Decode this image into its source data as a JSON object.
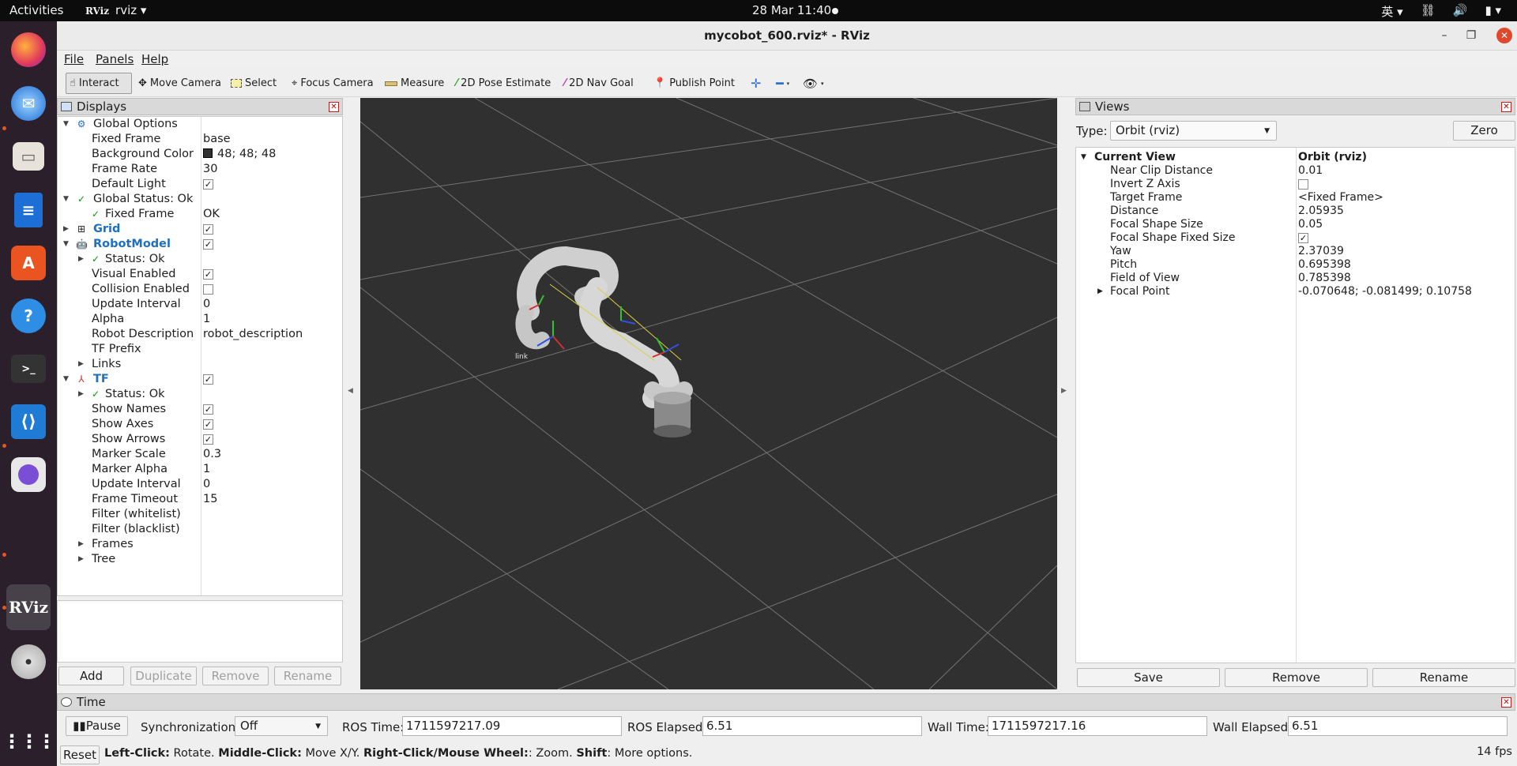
{
  "topbar": {
    "activities": "Activities",
    "app_name": "rviz",
    "app_logo": "RViz",
    "clock": "28 Mar  11:40",
    "input_method": "英",
    "tray_icons": [
      "network-icon",
      "volume-icon",
      "battery-icon"
    ]
  },
  "dock": {
    "apps": [
      "Firefox",
      "Thunderbird",
      "Files",
      "LibreOffice Writer",
      "Ubuntu Software",
      "Help",
      "Terminal",
      "Visual Studio Code",
      "Cheese",
      "RViz",
      "Disc",
      "Show Applications"
    ],
    "rviz_label": "RViz"
  },
  "window": {
    "title": "mycobot_600.rviz* - RViz",
    "menus": [
      "File",
      "Panels",
      "Help"
    ]
  },
  "toolbar": {
    "tools": [
      "Interact",
      "Move Camera",
      "Select",
      "Focus Camera",
      "Measure",
      "2D Pose Estimate",
      "2D Nav Goal",
      "Publish Point"
    ]
  },
  "displays": {
    "title": "Displays",
    "rows": {
      "global_options": "Global Options",
      "fixed_frame_lbl": "Fixed Frame",
      "fixed_frame_val": "base",
      "bg_color_lbl": "Background Color",
      "bg_color_val": "48; 48; 48",
      "frame_rate_lbl": "Frame Rate",
      "frame_rate_val": "30",
      "default_light_lbl": "Default Light",
      "global_status": "Global Status: Ok",
      "gs_fixed_frame_lbl": "Fixed Frame",
      "gs_fixed_frame_val": "OK",
      "grid": "Grid",
      "robot_model": "RobotModel",
      "rm_status": "Status: Ok",
      "visual_enabled": "Visual Enabled",
      "collision_enabled": "Collision Enabled",
      "rm_update_interval_lbl": "Update Interval",
      "rm_update_interval_val": "0",
      "alpha_lbl": "Alpha",
      "alpha_val": "1",
      "robot_desc_lbl": "Robot Description",
      "robot_desc_val": "robot_description",
      "tf_prefix": "TF Prefix",
      "links": "Links",
      "tf": "TF",
      "tf_status": "Status: Ok",
      "show_names": "Show Names",
      "show_axes": "Show Axes",
      "show_arrows": "Show Arrows",
      "marker_scale_lbl": "Marker Scale",
      "marker_scale_val": "0.3",
      "marker_alpha_lbl": "Marker Alpha",
      "marker_alpha_val": "1",
      "tf_update_interval_lbl": "Update Interval",
      "tf_update_interval_val": "0",
      "frame_timeout_lbl": "Frame Timeout",
      "frame_timeout_val": "15",
      "filter_white": "Filter (whitelist)",
      "filter_black": "Filter (blacklist)",
      "frames": "Frames",
      "tree": "Tree"
    },
    "buttons": {
      "add": "Add",
      "duplicate": "Duplicate",
      "remove": "Remove",
      "rename": "Rename"
    }
  },
  "viewport": {
    "link_label": "link",
    "background_color": "#303030"
  },
  "views": {
    "title": "Views",
    "type_label": "Type:",
    "type_value": "Orbit (rviz)",
    "zero": "Zero",
    "current_view_lbl": "Current View",
    "current_view_val": "Orbit (rviz)",
    "props": [
      {
        "label": "Near Clip Distance",
        "value": "0.01"
      },
      {
        "label": "Invert Z Axis",
        "value": ""
      },
      {
        "label": "Target Frame",
        "value": "<Fixed Frame>"
      },
      {
        "label": "Distance",
        "value": "2.05935"
      },
      {
        "label": "Focal Shape Size",
        "value": "0.05"
      },
      {
        "label": "Focal Shape Fixed Size",
        "value": ""
      },
      {
        "label": "Yaw",
        "value": "2.37039"
      },
      {
        "label": "Pitch",
        "value": "0.695398"
      },
      {
        "label": "Field of View",
        "value": "0.785398"
      },
      {
        "label": "Focal Point",
        "value": "-0.070648; -0.081499; 0.10758"
      }
    ],
    "buttons": {
      "save": "Save",
      "remove": "Remove",
      "rename": "Rename"
    }
  },
  "time": {
    "title": "Time",
    "pause": "Pause",
    "sync_label": "Synchronization:",
    "sync_value": "Off",
    "ros_time_label": "ROS Time:",
    "ros_time": "1711597217.09",
    "ros_elapsed_label": "ROS Elapsed:",
    "ros_elapsed": "6.51",
    "wall_time_label": "Wall Time:",
    "wall_time": "1711597217.16",
    "wall_elapsed_label": "Wall Elapsed:",
    "wall_elapsed": "6.51"
  },
  "status": {
    "reset": "Reset",
    "hint_left_click": "Left-Click:",
    "hint_rotate": " Rotate. ",
    "hint_middle_click": "Middle-Click:",
    "hint_move": " Move X/Y. ",
    "hint_right_click": "Right-Click/Mouse Wheel:",
    "hint_zoom": ": Zoom. ",
    "hint_shift": "Shift",
    "hint_more": ": More options.",
    "fps": "14 fps"
  }
}
